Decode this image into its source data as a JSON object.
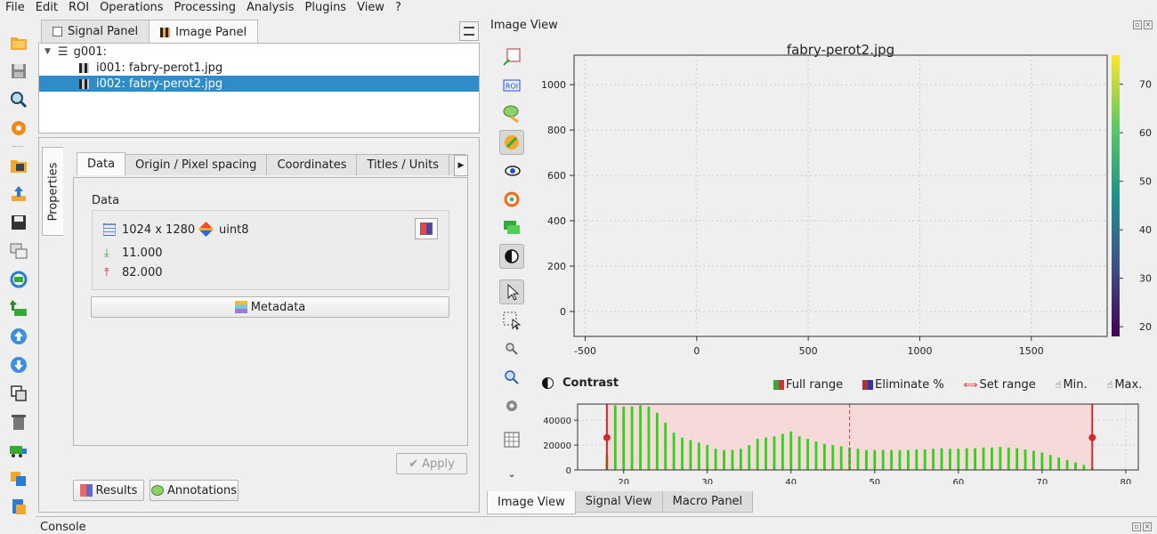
{
  "menu": [
    "File",
    "Edit",
    "ROI",
    "Operations",
    "Processing",
    "Analysis",
    "Plugins",
    "View",
    "?"
  ],
  "left": {
    "tabs": [
      "Signal Panel",
      "Image Panel"
    ],
    "tree": {
      "group": "g001:",
      "items": [
        "i001: fabry-perot1.jpg",
        "i002: fabry-perot2.jpg"
      ]
    },
    "properties_tab": "Properties",
    "inner_tabs": [
      "Data",
      "Origin / Pixel spacing",
      "Coordinates",
      "Titles / Units"
    ],
    "data_section": "Data",
    "shape": "1024 x 1280",
    "dtype": "uint8",
    "min": "11.000",
    "max": "82.000",
    "metadata_label": "Metadata",
    "apply_label": "Apply",
    "results_label": "Results",
    "annotations_label": "Annotations"
  },
  "right": {
    "title": "Image View",
    "bottom_tabs": [
      "Image View",
      "Signal View",
      "Macro Panel"
    ],
    "contrast": {
      "title": "Contrast",
      "buttons": [
        "Full range",
        "Eliminate %",
        "Set range",
        "Min.",
        "Max."
      ]
    }
  },
  "console_title": "Console",
  "colors": {
    "selection": "#308cc6",
    "histogram_bar": "#2fd21c",
    "range_line": "#d22a2a",
    "range_fill": "#f7d5d5"
  },
  "chart_data": [
    {
      "type": "heatmap",
      "title": "fabry-perot2.jpg",
      "x_ticks": [
        -500,
        0,
        500,
        1000,
        1500
      ],
      "y_ticks": [
        0,
        200,
        400,
        600,
        800,
        1000
      ],
      "xlim": [
        -550,
        1840
      ],
      "ylim": [
        1130,
        -110
      ],
      "image_extent": {
        "x": [
          0,
          1280
        ],
        "y": [
          0,
          1024
        ]
      },
      "center": [
        600,
        550
      ],
      "colorbar": {
        "ticks": [
          20,
          30,
          40,
          50,
          60,
          70
        ],
        "range": [
          18,
          76
        ],
        "colormap": "viridis"
      },
      "grid": true
    },
    {
      "type": "bar",
      "title": "Contrast",
      "x": [
        18,
        19,
        20,
        21,
        22,
        23,
        24,
        25,
        26,
        27,
        28,
        29,
        30,
        31,
        32,
        33,
        34,
        35,
        36,
        37,
        38,
        39,
        40,
        41,
        42,
        43,
        44,
        45,
        46,
        47,
        48,
        49,
        50,
        51,
        52,
        53,
        54,
        55,
        56,
        57,
        58,
        59,
        60,
        61,
        62,
        63,
        64,
        65,
        66,
        67,
        68,
        69,
        70,
        71,
        72,
        73,
        74,
        75,
        76
      ],
      "values": [
        12000,
        52000,
        51000,
        51000,
        52000,
        51000,
        46000,
        38000,
        30000,
        26000,
        24000,
        22000,
        20000,
        17000,
        16000,
        16000,
        17000,
        20000,
        25000,
        26000,
        27000,
        29000,
        31000,
        27000,
        25000,
        23000,
        21000,
        20000,
        19000,
        18000,
        17000,
        16000,
        16000,
        16000,
        16000,
        16000,
        16000,
        16500,
        16500,
        17000,
        17500,
        17000,
        17000,
        17500,
        17500,
        18000,
        18000,
        18500,
        18000,
        17500,
        16500,
        15500,
        14000,
        12000,
        10000,
        8000,
        6000,
        4000,
        2000
      ],
      "x_ticks": [
        20,
        30,
        40,
        50,
        60,
        70,
        80
      ],
      "y_ticks": [
        0,
        20000,
        40000
      ],
      "xlim": [
        14.5,
        81.5
      ],
      "ylim": [
        0,
        53000
      ],
      "range_min": 18,
      "range_max": 76,
      "range_mid": 47,
      "grid": true
    }
  ]
}
